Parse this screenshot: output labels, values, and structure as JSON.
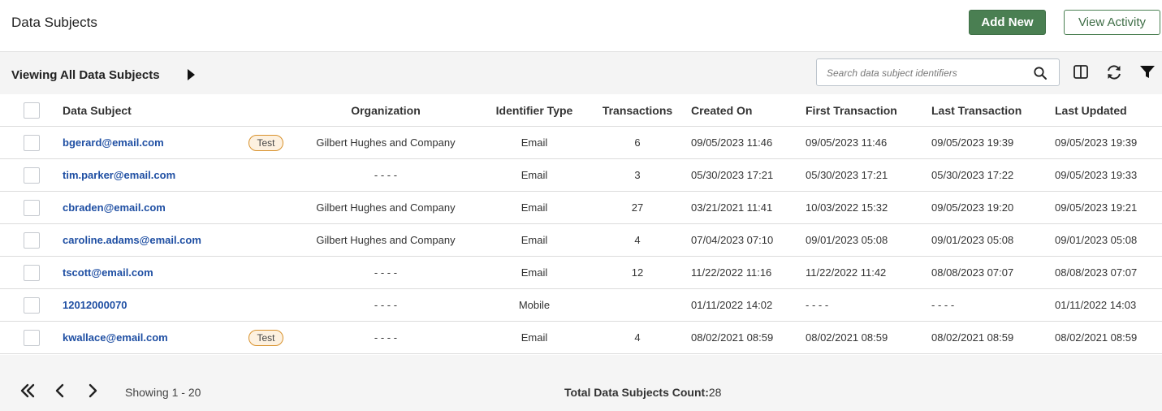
{
  "header": {
    "title": "Data Subjects",
    "add_new_label": "Add New",
    "view_activity_label": "View Activity"
  },
  "toolbar": {
    "view_label": "Viewing All Data Subjects",
    "search_placeholder": "Search data subject identifiers"
  },
  "table": {
    "columns": [
      "Data Subject",
      "Organization",
      "Identifier Type",
      "Transactions",
      "Created On",
      "First Transaction",
      "Last Transaction",
      "Last Updated"
    ],
    "rows": [
      {
        "subject": "bgerard@email.com",
        "tag": "Test",
        "organization": "Gilbert Hughes and Company",
        "identifier_type": "Email",
        "transactions": "6",
        "created_on": "09/05/2023 11:46",
        "first_transaction": "09/05/2023 11:46",
        "last_transaction": "09/05/2023 19:39",
        "last_updated": "09/05/2023 19:39"
      },
      {
        "subject": "tim.parker@email.com",
        "tag": "",
        "organization": "- - - -",
        "identifier_type": "Email",
        "transactions": "3",
        "created_on": "05/30/2023 17:21",
        "first_transaction": "05/30/2023 17:21",
        "last_transaction": "05/30/2023 17:22",
        "last_updated": "09/05/2023 19:33"
      },
      {
        "subject": "cbraden@email.com",
        "tag": "",
        "organization": "Gilbert Hughes and Company",
        "identifier_type": "Email",
        "transactions": "27",
        "created_on": "03/21/2021 11:41",
        "first_transaction": "10/03/2022 15:32",
        "last_transaction": "09/05/2023 19:20",
        "last_updated": "09/05/2023 19:21"
      },
      {
        "subject": "caroline.adams@email.com",
        "tag": "",
        "organization": "Gilbert Hughes and Company",
        "identifier_type": "Email",
        "transactions": "4",
        "created_on": "07/04/2023 07:10",
        "first_transaction": "09/01/2023 05:08",
        "last_transaction": "09/01/2023 05:08",
        "last_updated": "09/01/2023 05:08"
      },
      {
        "subject": "tscott@email.com",
        "tag": "",
        "organization": "- - - -",
        "identifier_type": "Email",
        "transactions": "12",
        "created_on": "11/22/2022 11:16",
        "first_transaction": "11/22/2022 11:42",
        "last_transaction": "08/08/2023 07:07",
        "last_updated": "08/08/2023 07:07"
      },
      {
        "subject": "12012000070",
        "tag": "",
        "organization": "- - - -",
        "identifier_type": "Mobile",
        "transactions": "",
        "created_on": "01/11/2022 14:02",
        "first_transaction": "- - - -",
        "last_transaction": "- - - -",
        "last_updated": "01/11/2022 14:03"
      },
      {
        "subject": "kwallace@email.com",
        "tag": "Test",
        "organization": "- - - -",
        "identifier_type": "Email",
        "transactions": "4",
        "created_on": "08/02/2021 08:59",
        "first_transaction": "08/02/2021 08:59",
        "last_transaction": "08/02/2021 08:59",
        "last_updated": "08/02/2021 08:59"
      }
    ]
  },
  "footer": {
    "showing_text": "Showing 1 - 20",
    "total_label": "Total Data Subjects Count:",
    "total_value": "28"
  },
  "colors": {
    "primary_green": "#4a7f52",
    "link_blue": "#1f4fa3",
    "tag_border": "#d8922d"
  },
  "icons": [
    "search-icon",
    "columns-icon",
    "refresh-icon",
    "filter-icon",
    "first-page-icon",
    "previous-page-icon",
    "next-page-icon"
  ]
}
